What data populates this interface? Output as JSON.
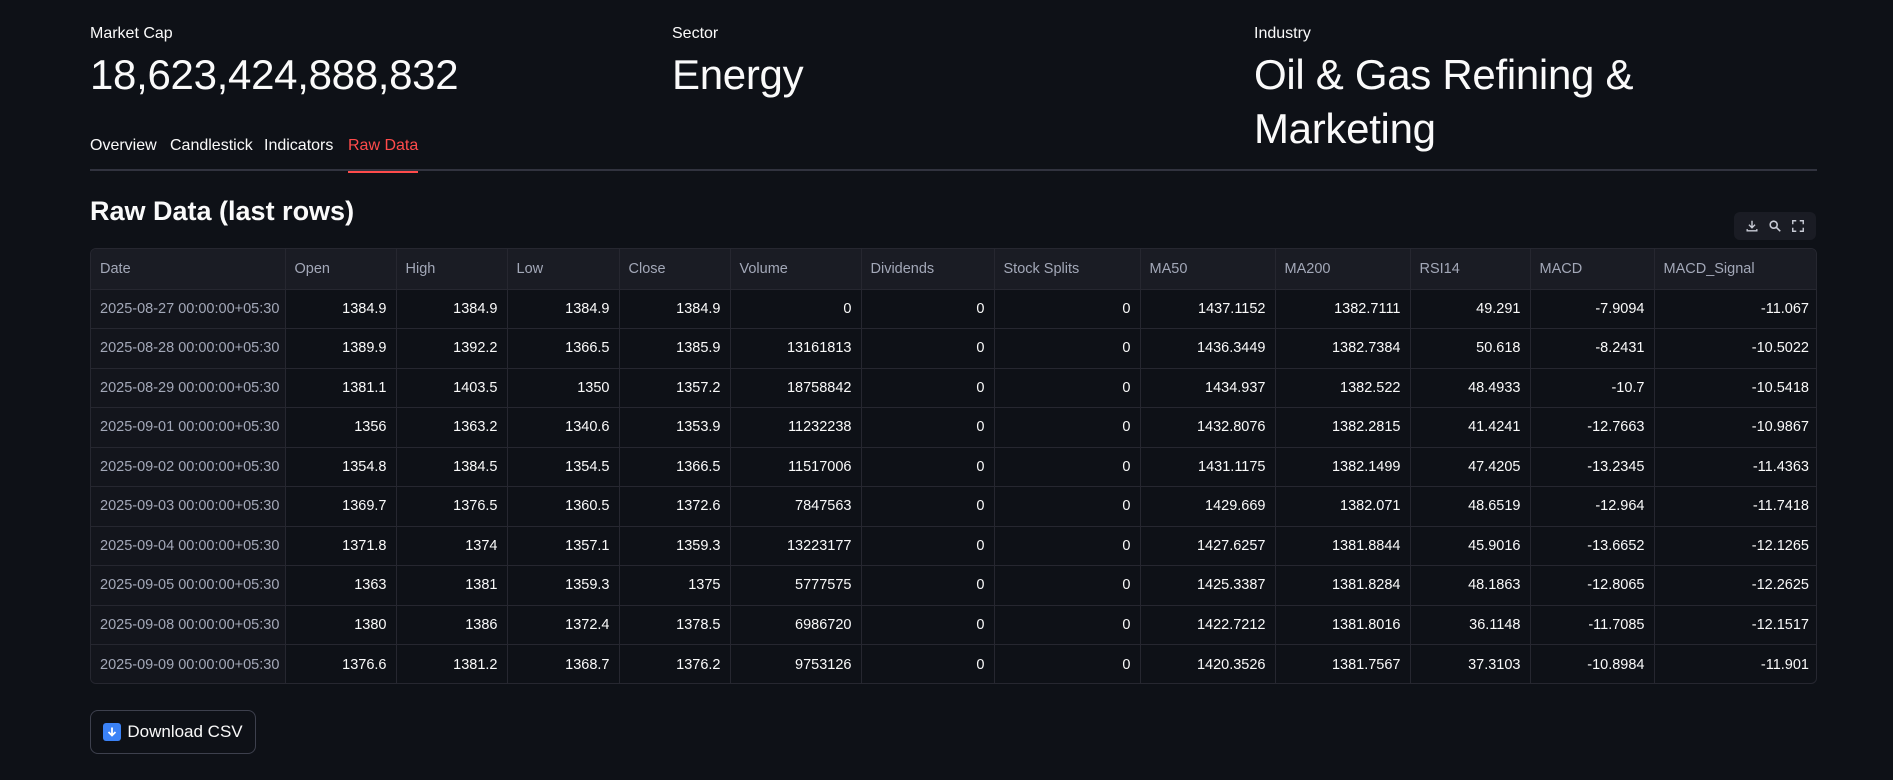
{
  "metrics": [
    {
      "label": "Market Cap",
      "value": "18,623,424,888,832"
    },
    {
      "label": "Sector",
      "value": "Energy"
    },
    {
      "label": "Industry",
      "value": "Oil & Gas Refining & Marketing"
    }
  ],
  "tabs": [
    {
      "label": "Overview",
      "active": false
    },
    {
      "label": "Candlestick",
      "active": false
    },
    {
      "label": "Indicators",
      "active": false
    },
    {
      "label": "Raw Data",
      "active": true
    }
  ],
  "section": {
    "title": "Raw Data (last rows)"
  },
  "toolbar": {
    "icons": [
      "download-icon",
      "search-icon",
      "fullscreen-icon"
    ]
  },
  "table": {
    "columns": [
      "Date",
      "Open",
      "High",
      "Low",
      "Close",
      "Volume",
      "Dividends",
      "Stock Splits",
      "MA50",
      "MA200",
      "RSI14",
      "MACD",
      "MACD_Signal"
    ],
    "rows": [
      [
        "2025-08-27 00:00:00+05:30",
        "1384.9",
        "1384.9",
        "1384.9",
        "1384.9",
        "0",
        "0",
        "0",
        "1437.1152",
        "1382.7111",
        "49.291",
        "-7.9094",
        "-11.067"
      ],
      [
        "2025-08-28 00:00:00+05:30",
        "1389.9",
        "1392.2",
        "1366.5",
        "1385.9",
        "13161813",
        "0",
        "0",
        "1436.3449",
        "1382.7384",
        "50.618",
        "-8.2431",
        "-10.5022"
      ],
      [
        "2025-08-29 00:00:00+05:30",
        "1381.1",
        "1403.5",
        "1350",
        "1357.2",
        "18758842",
        "0",
        "0",
        "1434.937",
        "1382.522",
        "48.4933",
        "-10.7",
        "-10.5418"
      ],
      [
        "2025-09-01 00:00:00+05:30",
        "1356",
        "1363.2",
        "1340.6",
        "1353.9",
        "11232238",
        "0",
        "0",
        "1432.8076",
        "1382.2815",
        "41.4241",
        "-12.7663",
        "-10.9867"
      ],
      [
        "2025-09-02 00:00:00+05:30",
        "1354.8",
        "1384.5",
        "1354.5",
        "1366.5",
        "11517006",
        "0",
        "0",
        "1431.1175",
        "1382.1499",
        "47.4205",
        "-13.2345",
        "-11.4363"
      ],
      [
        "2025-09-03 00:00:00+05:30",
        "1369.7",
        "1376.5",
        "1360.5",
        "1372.6",
        "7847563",
        "0",
        "0",
        "1429.669",
        "1382.071",
        "48.6519",
        "-12.964",
        "-11.7418"
      ],
      [
        "2025-09-04 00:00:00+05:30",
        "1371.8",
        "1374",
        "1357.1",
        "1359.3",
        "13223177",
        "0",
        "0",
        "1427.6257",
        "1381.8844",
        "45.9016",
        "-13.6652",
        "-12.1265"
      ],
      [
        "2025-09-05 00:00:00+05:30",
        "1363",
        "1381",
        "1359.3",
        "1375",
        "5777575",
        "0",
        "0",
        "1425.3387",
        "1381.8284",
        "48.1863",
        "-12.8065",
        "-12.2625"
      ],
      [
        "2025-09-08 00:00:00+05:30",
        "1380",
        "1386",
        "1372.4",
        "1378.5",
        "6986720",
        "0",
        "0",
        "1422.7212",
        "1381.8016",
        "36.1148",
        "-11.7085",
        "-12.1517"
      ],
      [
        "2025-09-09 00:00:00+05:30",
        "1376.6",
        "1381.2",
        "1368.7",
        "1376.2",
        "9753126",
        "0",
        "0",
        "1420.3526",
        "1381.7567",
        "37.3103",
        "-10.8984",
        "-11.901"
      ]
    ]
  },
  "download": {
    "label": "Download CSV",
    "icon": "down-arrow-icon"
  },
  "colors": {
    "background": "#0e1117",
    "accent": "#ff4b4b",
    "text": "#fafafa",
    "muted": "#a3a8b8",
    "border": "#262730"
  }
}
